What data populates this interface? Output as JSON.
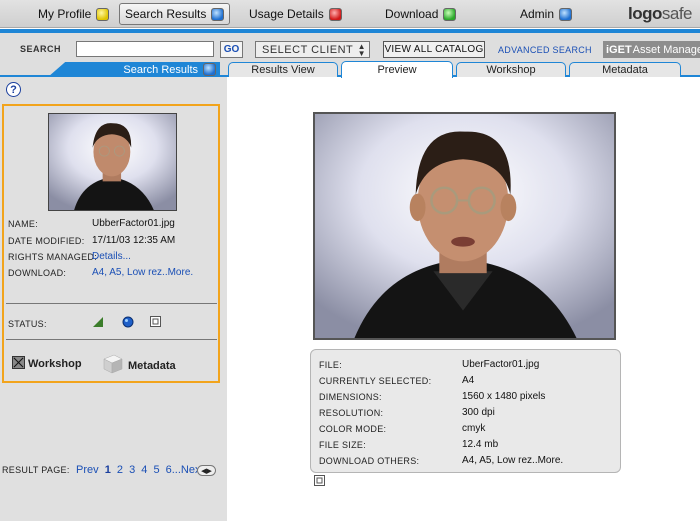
{
  "nav": {
    "items": [
      {
        "label": "My Profile",
        "icon": "yellow-dot-icon",
        "color": "#e0c400"
      },
      {
        "label": "Search Results",
        "icon": "blue-dot-icon",
        "color": "#1e6fd0",
        "active": true
      },
      {
        "label": "Usage Details",
        "icon": "red-dot-icon",
        "color": "#d01818"
      },
      {
        "label": "Download",
        "icon": "green-dot-icon",
        "color": "#2aa82a"
      },
      {
        "label": "Admin",
        "icon": "blue-dot-icon",
        "color": "#1e6fd0"
      }
    ],
    "logo": {
      "part1": "logo",
      "part2": "safe"
    }
  },
  "search": {
    "label": "SEARCH",
    "value": "",
    "go_label": "GO",
    "select_client": "SELECT CLIENT",
    "view_all": "VIEW ALL CATALOG",
    "advanced": "ADVANCED SEARCH",
    "iget": {
      "bold": "iGET",
      "text": "Asset Manager"
    }
  },
  "tabs": {
    "search_results": "Search Results",
    "results_view": "Results View",
    "preview": "Preview",
    "workshop": "Workshop",
    "metadata": "Metadata"
  },
  "sidebar": {
    "help": "?",
    "name_label": "NAME:",
    "name_value": "UbberFactor01.jpg",
    "date_label": "DATE MODIFIED:",
    "date_value": "17/11/03 12:35 AM",
    "rights_label": "RIGHTS MANAGED:",
    "rights_value": "Details...",
    "download_label": "DOWNLOAD:",
    "download_value": "A4, A5, Low rez..More.",
    "status_label": "STATUS:",
    "workshop_label": "Workshop",
    "metadata_label": "Metadata"
  },
  "pager": {
    "label": "RESULT PAGE:",
    "prev": "Prev",
    "pages": [
      "1",
      "2",
      "3",
      "4",
      "5",
      "6"
    ],
    "current": "1",
    "ellipsis": "...",
    "next": "Next",
    "arrows": "◀▶"
  },
  "info": {
    "file_label": "FILE:",
    "file_value": "UberFactor01.jpg",
    "selected_label": "CURRENTLY SELECTED:",
    "selected_value": "A4",
    "dimensions_label": "DIMENSIONS:",
    "dimensions_value": "1560 x 1480 pixels",
    "resolution_label": "RESOLUTION:",
    "resolution_value": "300 dpi",
    "colormode_label": "COLOR MODE:",
    "colormode_value": "cmyk",
    "filesize_label": "FILE SIZE:",
    "filesize_value": "12.4 mb",
    "download_label": "DOWNLOAD OTHERS:",
    "download_value": "A4, A5, Low rez..More."
  },
  "colors": {
    "accent": "#1f86d6",
    "highlight": "#f2a41c",
    "link": "#1a4fb5"
  }
}
